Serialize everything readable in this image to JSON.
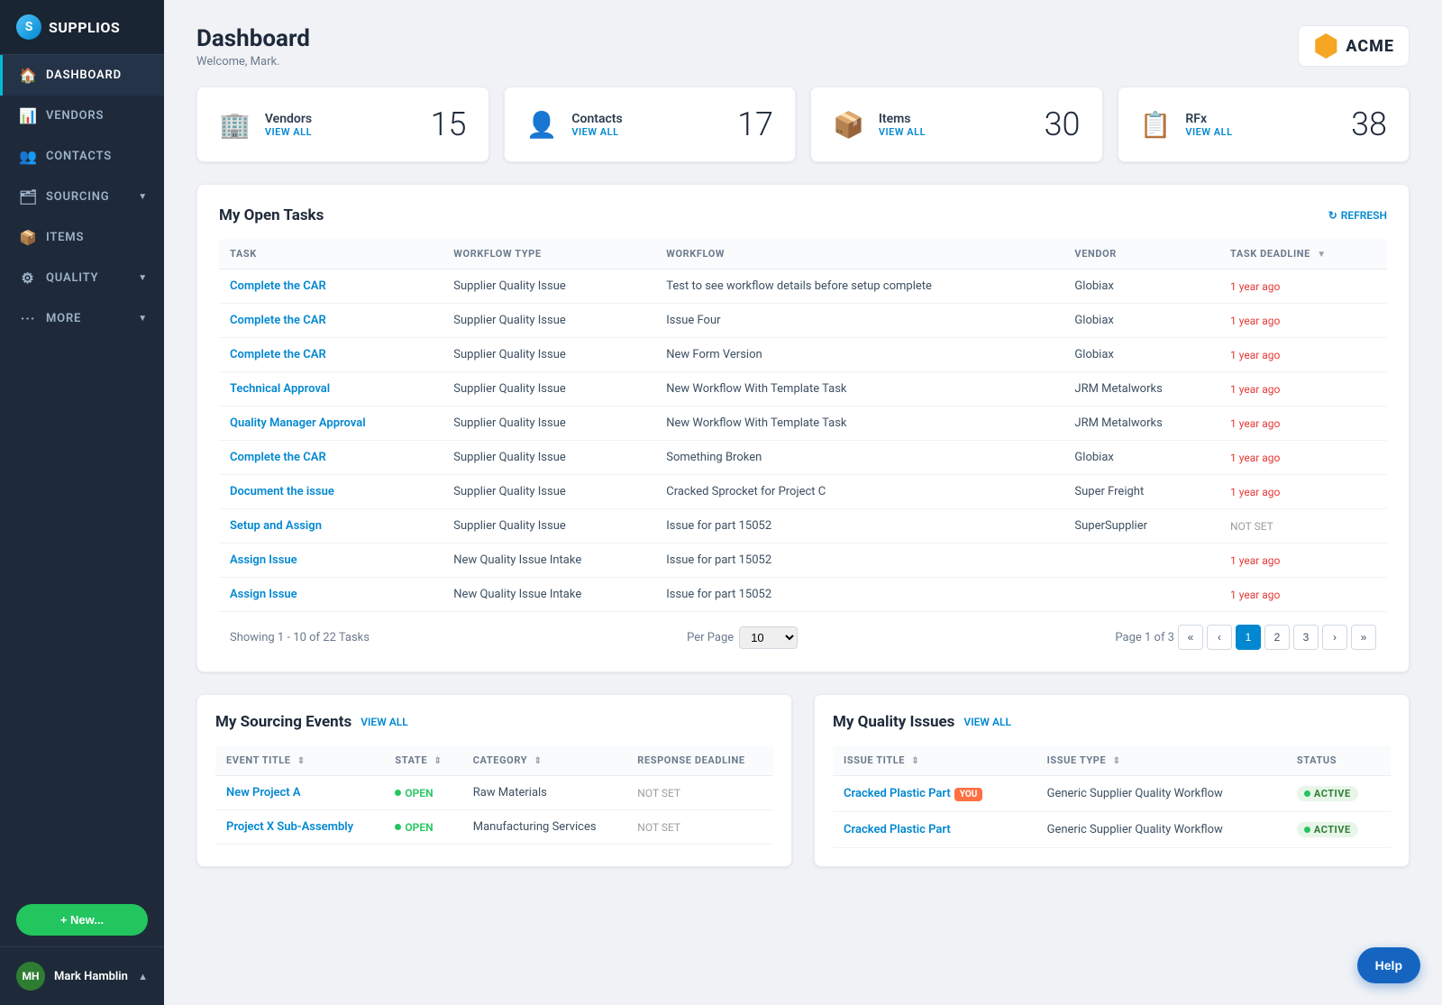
{
  "logo": {
    "text": "SUPPLIOS",
    "initial": "S"
  },
  "nav": {
    "items": [
      {
        "id": "dashboard",
        "label": "DASHBOARD",
        "icon": "🏠",
        "active": true,
        "hasChevron": false
      },
      {
        "id": "vendors",
        "label": "VENDORS",
        "icon": "📊",
        "active": false,
        "hasChevron": false
      },
      {
        "id": "contacts",
        "label": "CONTACTS",
        "icon": "👥",
        "active": false,
        "hasChevron": false
      },
      {
        "id": "sourcing",
        "label": "SOURCING",
        "icon": "🗂",
        "active": false,
        "hasChevron": true
      },
      {
        "id": "items",
        "label": "ITEMS",
        "icon": "📦",
        "active": false,
        "hasChevron": false
      },
      {
        "id": "quality",
        "label": "QUALITY",
        "icon": "⚙",
        "active": false,
        "hasChevron": true
      },
      {
        "id": "more",
        "label": "MORE",
        "icon": "···",
        "active": false,
        "hasChevron": true
      }
    ]
  },
  "user": {
    "initials": "MH",
    "name": "Mark Hamblin"
  },
  "new_btn_label": "+ New...",
  "header": {
    "title": "Dashboard",
    "welcome": "Welcome, Mark.",
    "company": "ACME"
  },
  "stat_cards": [
    {
      "id": "vendors",
      "label": "Vendors",
      "view_label": "VIEW ALL",
      "value": "15",
      "icon": "🏢"
    },
    {
      "id": "contacts",
      "label": "Contacts",
      "view_label": "VIEW ALL",
      "value": "17",
      "icon": "👤"
    },
    {
      "id": "items",
      "label": "Items",
      "view_label": "VIEW ALL",
      "value": "30",
      "icon": "📦"
    },
    {
      "id": "rfx",
      "label": "RFx",
      "view_label": "VIEW ALL",
      "value": "38",
      "icon": "📋"
    }
  ],
  "open_tasks": {
    "title": "My Open Tasks",
    "refresh_label": "REFRESH",
    "columns": [
      "TASK",
      "WORKFLOW TYPE",
      "WORKFLOW",
      "VENDOR",
      "TASK DEADLINE"
    ],
    "rows": [
      {
        "task": "Complete the CAR",
        "workflow_type": "Supplier Quality Issue",
        "workflow": "Test to see workflow details before setup complete",
        "vendor": "Globiax",
        "deadline": "1 year ago",
        "deadline_red": true
      },
      {
        "task": "Complete the CAR",
        "workflow_type": "Supplier Quality Issue",
        "workflow": "Issue Four",
        "vendor": "Globiax",
        "deadline": "1 year ago",
        "deadline_red": true
      },
      {
        "task": "Complete the CAR",
        "workflow_type": "Supplier Quality Issue",
        "workflow": "New Form Version",
        "vendor": "Globiax",
        "deadline": "1 year ago",
        "deadline_red": true
      },
      {
        "task": "Technical Approval",
        "workflow_type": "Supplier Quality Issue",
        "workflow": "New Workflow With Template Task",
        "vendor": "JRM Metalworks",
        "deadline": "1 year ago",
        "deadline_red": true
      },
      {
        "task": "Quality Manager Approval",
        "workflow_type": "Supplier Quality Issue",
        "workflow": "New Workflow With Template Task",
        "vendor": "JRM Metalworks",
        "deadline": "1 year ago",
        "deadline_red": true
      },
      {
        "task": "Complete the CAR",
        "workflow_type": "Supplier Quality Issue",
        "workflow": "Something Broken",
        "vendor": "Globiax",
        "deadline": "1 year ago",
        "deadline_red": true
      },
      {
        "task": "Document the issue",
        "workflow_type": "Supplier Quality Issue",
        "workflow": "Cracked Sprocket for Project C",
        "vendor": "Super Freight",
        "deadline": "1 year ago",
        "deadline_red": true
      },
      {
        "task": "Setup and Assign",
        "workflow_type": "Supplier Quality Issue",
        "workflow": "Issue for part 15052",
        "vendor": "SuperSupplier",
        "deadline": "NOT SET",
        "deadline_red": false
      },
      {
        "task": "Assign Issue",
        "workflow_type": "New Quality Issue Intake",
        "workflow": "Issue for part 15052",
        "vendor": "",
        "deadline": "1 year ago",
        "deadline_red": true
      },
      {
        "task": "Assign Issue",
        "workflow_type": "New Quality Issue Intake",
        "workflow": "Issue for part 15052",
        "vendor": "",
        "deadline": "1 year ago",
        "deadline_red": true
      }
    ],
    "pagination": {
      "showing_start": 1,
      "showing_end": 10,
      "total": 22,
      "label": "Tasks",
      "per_page": 10,
      "current_page": 1,
      "total_pages": 3
    }
  },
  "sourcing_events": {
    "title": "My Sourcing Events",
    "view_all": "VIEW ALL",
    "columns": [
      "EVENT TITLE",
      "STATE",
      "CATEGORY",
      "RESPONSE DEADLINE"
    ],
    "rows": [
      {
        "title": "New Project A",
        "state": "OPEN",
        "category": "Raw Materials",
        "deadline": "NOT SET"
      },
      {
        "title": "Project X Sub-Assembly",
        "state": "OPEN",
        "category": "Manufacturing Services",
        "deadline": "NOT SET"
      }
    ]
  },
  "quality_issues": {
    "title": "My Quality Issues",
    "view_all": "VIEW ALL",
    "columns": [
      "ISSUE TITLE",
      "ISSUE TYPE",
      "STATUS"
    ],
    "rows": [
      {
        "title": "Cracked Plastic Part",
        "badge": "YOU",
        "type": "Generic Supplier Quality Workflow",
        "status": "ACTIVE"
      },
      {
        "title": "Cracked Plastic Part",
        "badge": "",
        "type": "Generic Supplier Quality Workflow",
        "status": "ACTIVE"
      }
    ]
  },
  "help_label": "Help"
}
